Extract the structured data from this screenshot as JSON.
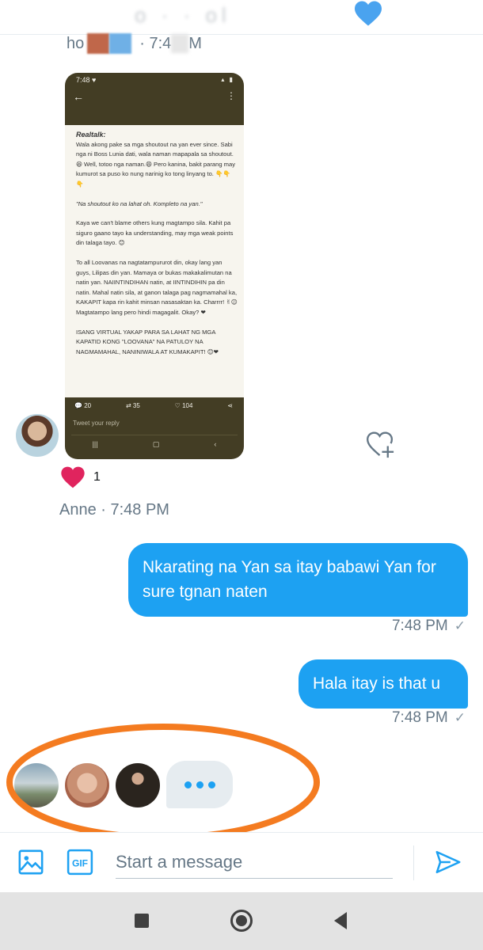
{
  "header": {
    "title": "o  ·  ·  ol",
    "heart_icon": "heart-icon",
    "heart_color": "#4aa3ef"
  },
  "top_sender": {
    "name_partial": "ho",
    "time_partial": "· 7:4",
    "time_suffix": "M"
  },
  "shared_image": {
    "status_time": "7:48",
    "realtalk": "Realtalk:",
    "paragraph1": "Wala akong pake sa mga shoutout na yan ever since. Sabi nga ni Boss Lunia dati, wala naman mapapala sa shoutout. 😆 Well, totoo nga naman.😄 Pero kanina, bakit parang may kumurot sa puso ko nung narinig ko tong linyang to. 👇👇👇",
    "quote": "\"Na shoutout ko na lahat oh. Kompleto na yan.\"",
    "paragraph2": "Kaya we can't blame others kung magtampo sila. Kahit pa siguro gaano tayo ka understanding, may mga weak points din talaga tayo. 😊",
    "paragraph3": "To all Loovanas na nagtatampururot din, okay lang yan guys, Lilipas din yan. Mamaya or bukas makakalimutan na natin yan. NAIINTINDIHAN natin, at IINTINDIHIN pa din natin. Mahal natin sila, at ganon talaga pag nagmamahal ka, KAKAPIT kapa rin kahit minsan nasasaktan ka. Charrrr! ✌😉 Magtatampo lang pero hindi magagalit. Okay? ❤",
    "paragraph4": "ISANG VIRTUAL YAKAP PARA SA LAHAT NG MGA KAPATID KONG \"LOOVANA\" NA PATULOY NA NAGMAMAHAL, NANINIWALA AT KUMAKAPIT! 😊❤",
    "replies": "20",
    "retweets": "35",
    "likes": "104",
    "reply_placeholder": "Tweet your reply"
  },
  "reaction": {
    "icon": "heart-filled-icon",
    "count": "1",
    "color": "#e0245e"
  },
  "received_meta": "Anne · 7:48 PM",
  "messages": [
    {
      "text": "Nkarating na Yan sa itay babawi Yan for sure tgnan naten",
      "time": "7:48 PM",
      "status": "✓"
    },
    {
      "text": "Hala itay is that u",
      "time": "7:48 PM",
      "status": "✓"
    }
  ],
  "composer": {
    "placeholder": "Start a message",
    "image_icon": "image-icon",
    "gif_label": "GIF",
    "send_icon": "send-icon"
  },
  "colors": {
    "accent": "#1da1f2",
    "annotation": "#f47b20",
    "muted": "#657786"
  }
}
